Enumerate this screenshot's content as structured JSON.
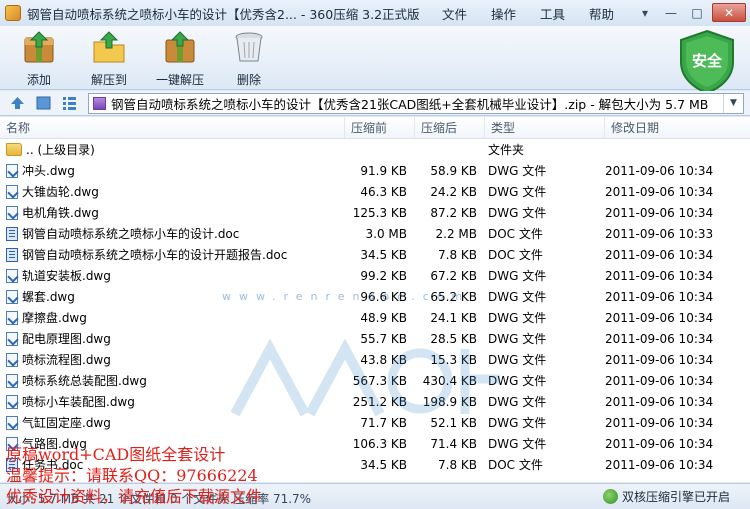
{
  "window": {
    "title": "钢管自动喷标系统之喷标小车的设计【优秀含2... - 360压缩 3.2正式版",
    "menu": [
      "文件",
      "操作",
      "工具",
      "帮助"
    ],
    "controls": [
      "▾",
      "—",
      "□",
      "✕"
    ]
  },
  "toolbar": {
    "buttons": [
      {
        "label": "添加",
        "icon": "add-archive-icon"
      },
      {
        "label": "解压到",
        "icon": "extract-to-icon"
      },
      {
        "label": "一键解压",
        "icon": "one-click-extract-icon"
      },
      {
        "label": "删除",
        "icon": "trash-can-icon"
      }
    ],
    "security_badge": "安全"
  },
  "address": {
    "path": "钢管自动喷标系统之喷标小车的设计【优秀含21张CAD图纸+全套机械毕业设计】.zip - 解包大小为 5.7 MB"
  },
  "columns": {
    "name": "名称",
    "size": "压缩前",
    "packed": "压缩后",
    "type": "类型",
    "modified": "修改日期"
  },
  "files": [
    {
      "name": ".. (上级目录)",
      "size": "",
      "packed": "",
      "type": "文件夹",
      "modified": "",
      "kind": "folder"
    },
    {
      "name": "冲头.dwg",
      "size": "91.9 KB",
      "packed": "58.9 KB",
      "type": "DWG 文件",
      "modified": "2011-09-06 10:34",
      "kind": "dwg"
    },
    {
      "name": "大锥齿轮.dwg",
      "size": "46.3 KB",
      "packed": "24.2 KB",
      "type": "DWG 文件",
      "modified": "2011-09-06 10:34",
      "kind": "dwg"
    },
    {
      "name": "电机角铁.dwg",
      "size": "125.3 KB",
      "packed": "87.2 KB",
      "type": "DWG 文件",
      "modified": "2011-09-06 10:34",
      "kind": "dwg"
    },
    {
      "name": "钢管自动喷标系统之喷标小车的设计.doc",
      "size": "3.0 MB",
      "packed": "2.2 MB",
      "type": "DOC 文件",
      "modified": "2011-09-06 10:33",
      "kind": "doc"
    },
    {
      "name": "钢管自动喷标系统之喷标小车的设计开题报告.doc",
      "size": "34.5 KB",
      "packed": "7.8 KB",
      "type": "DOC 文件",
      "modified": "2011-09-06 10:34",
      "kind": "doc"
    },
    {
      "name": "轨道安装板.dwg",
      "size": "99.2 KB",
      "packed": "67.2 KB",
      "type": "DWG 文件",
      "modified": "2011-09-06 10:34",
      "kind": "dwg"
    },
    {
      "name": "螺套.dwg",
      "size": "96.6 KB",
      "packed": "65.2 KB",
      "type": "DWG 文件",
      "modified": "2011-09-06 10:34",
      "kind": "dwg"
    },
    {
      "name": "摩擦盘.dwg",
      "size": "48.9 KB",
      "packed": "24.1 KB",
      "type": "DWG 文件",
      "modified": "2011-09-06 10:34",
      "kind": "dwg"
    },
    {
      "name": "配电原理图.dwg",
      "size": "55.7 KB",
      "packed": "28.5 KB",
      "type": "DWG 文件",
      "modified": "2011-09-06 10:34",
      "kind": "dwg"
    },
    {
      "name": "喷标流程图.dwg",
      "size": "43.8 KB",
      "packed": "15.3 KB",
      "type": "DWG 文件",
      "modified": "2011-09-06 10:34",
      "kind": "dwg"
    },
    {
      "name": "喷标系统总装配图.dwg",
      "size": "567.3 KB",
      "packed": "430.4 KB",
      "type": "DWG 文件",
      "modified": "2011-09-06 10:34",
      "kind": "dwg"
    },
    {
      "name": "喷标小车装配图.dwg",
      "size": "251.2 KB",
      "packed": "198.9 KB",
      "type": "DWG 文件",
      "modified": "2011-09-06 10:34",
      "kind": "dwg"
    },
    {
      "name": "气缸固定座.dwg",
      "size": "71.7 KB",
      "packed": "52.1 KB",
      "type": "DWG 文件",
      "modified": "2011-09-06 10:34",
      "kind": "dwg"
    },
    {
      "name": "气路图.dwg",
      "size": "106.3 KB",
      "packed": "71.4 KB",
      "type": "DWG 文件",
      "modified": "2011-09-06 10:34",
      "kind": "dwg"
    },
    {
      "name": "任务书.doc",
      "size": "34.5 KB",
      "packed": "7.8 KB",
      "type": "DOC 文件",
      "modified": "2011-09-06 10:34",
      "kind": "doc"
    }
  ],
  "status": {
    "text": "大小: 5.7 MB 共 21 个文件和 0 个文件夹 压缩率 71.7%",
    "engine": "双核压缩引擎已开启"
  },
  "overlay": {
    "line1": "原稿word+CAD图纸全套设计",
    "line2": "温馨提示：请联系QQ：97666224",
    "line3": "优秀设计资料，请充值后下载源文件"
  },
  "watermark_url": "www.renrendoc.com"
}
